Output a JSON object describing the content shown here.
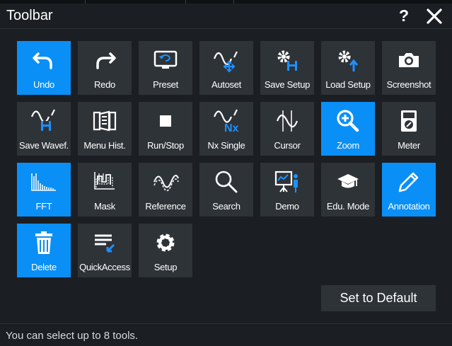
{
  "window": {
    "title": "Toolbar",
    "help_label": "?",
    "close_icon": "close-icon"
  },
  "colors": {
    "background": "#1b1f23",
    "tile": "#2e3338",
    "selected": "#0a8ff6"
  },
  "tools": [
    {
      "label": "Undo",
      "icon": "undo-icon",
      "selected": true
    },
    {
      "label": "Redo",
      "icon": "redo-icon",
      "selected": false
    },
    {
      "label": "Preset",
      "icon": "preset-icon",
      "selected": false
    },
    {
      "label": "Autoset",
      "icon": "autoset-icon",
      "selected": false
    },
    {
      "label": "Save Setup",
      "icon": "save-setup-icon",
      "selected": false
    },
    {
      "label": "Load Setup",
      "icon": "load-setup-icon",
      "selected": false
    },
    {
      "label": "Screenshot",
      "icon": "camera-icon",
      "selected": false
    },
    {
      "label": "Save Wavef.",
      "icon": "save-waveform-icon",
      "selected": false
    },
    {
      "label": "Menu Hist.",
      "icon": "menu-history-icon",
      "selected": false
    },
    {
      "label": "Run/Stop",
      "icon": "stop-icon",
      "selected": false
    },
    {
      "label": "Nx Single",
      "icon": "nx-single-icon",
      "icon_text": "Nx",
      "selected": false
    },
    {
      "label": "Cursor",
      "icon": "cursor-icon",
      "selected": false
    },
    {
      "label": "Zoom",
      "icon": "zoom-icon",
      "selected": true
    },
    {
      "label": "Meter",
      "icon": "meter-icon",
      "selected": false
    },
    {
      "label": "FFT",
      "icon": "fft-icon",
      "selected": true
    },
    {
      "label": "Mask",
      "icon": "mask-icon",
      "selected": false
    },
    {
      "label": "Reference",
      "icon": "reference-icon",
      "selected": false
    },
    {
      "label": "Search",
      "icon": "search-icon",
      "selected": false
    },
    {
      "label": "Demo",
      "icon": "demo-icon",
      "selected": false
    },
    {
      "label": "Edu. Mode",
      "icon": "education-icon",
      "selected": false
    },
    {
      "label": "Annotation",
      "icon": "pencil-icon",
      "selected": true
    },
    {
      "label": "Delete",
      "icon": "trash-icon",
      "selected": true
    },
    {
      "label": "QuickAccess",
      "icon": "quick-access-icon",
      "selected": false
    },
    {
      "label": "Setup",
      "icon": "gear-icon",
      "selected": false
    }
  ],
  "default_button": "Set to Default",
  "status_text": "You can select up to 8 tools."
}
